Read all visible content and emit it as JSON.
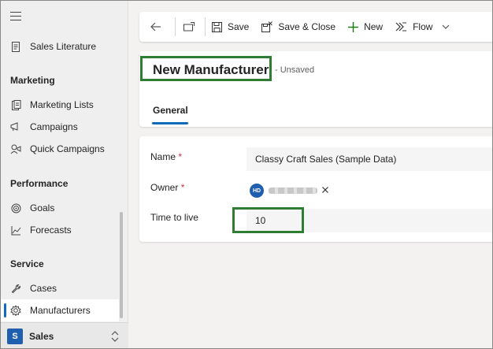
{
  "sidebar": {
    "items": {
      "sales_literature": "Sales Literature",
      "marketing_lists": "Marketing Lists",
      "campaigns": "Campaigns",
      "quick_campaigns": "Quick Campaigns",
      "goals": "Goals",
      "forecasts": "Forecasts",
      "cases": "Cases",
      "manufacturers": "Manufacturers"
    },
    "groups": {
      "marketing": "Marketing",
      "performance": "Performance",
      "service": "Service"
    },
    "area": {
      "badge": "S",
      "name": "Sales"
    }
  },
  "commandbar": {
    "save": "Save",
    "save_close": "Save & Close",
    "new": "New",
    "flow": "Flow"
  },
  "record": {
    "title": "New Manufacturer",
    "status": "- Unsaved",
    "tab": "General"
  },
  "form": {
    "name_label": "Name",
    "name_value": "Classy Craft Sales (Sample Data)",
    "owner_label": "Owner",
    "owner_initials": "HD",
    "ttl_label": "Time to live",
    "ttl_value": "10",
    "required_marker": "*"
  },
  "colors": {
    "accent": "#0f6cbd",
    "highlight": "#2e7d32",
    "required": "#c4314b"
  }
}
